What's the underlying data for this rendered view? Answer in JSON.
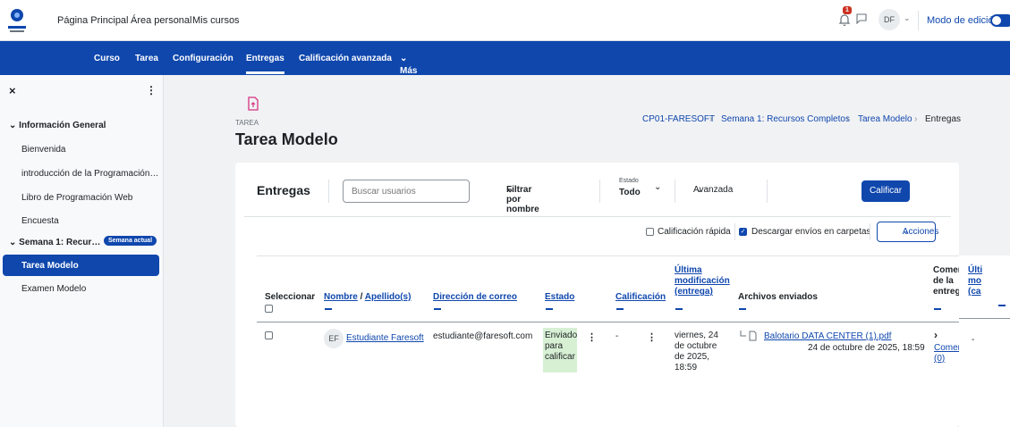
{
  "topnav": {
    "items": [
      "Página Principal",
      "Área personal",
      "Mis cursos"
    ],
    "notif_count": "1",
    "user_initials": "DF",
    "edit_mode_label": "Modo de edición"
  },
  "secondary_nav": [
    "Curso",
    "Tarea",
    "Configuración",
    "Entregas",
    "Calificación avanzada",
    "Más"
  ],
  "drawer": {
    "close": "×",
    "section1": "Información General",
    "items1": [
      "Bienvenida",
      "introducción de la Programación…",
      "Libro de Programación Web",
      "Encuesta"
    ],
    "section2": "Semana 1: Recur…",
    "section2_badge": "Semana actual",
    "items2": [
      "Tarea Modelo",
      "Examen Modelo"
    ]
  },
  "page": {
    "type_label": "TAREA",
    "title": "Tarea Modelo",
    "breadcrumb": [
      "CP01-FARESOFT",
      "Semana 1: Recursos Completos",
      "Tarea Modelo",
      "Entregas"
    ]
  },
  "toolbar": {
    "heading": "Entregas",
    "search_placeholder": "Buscar usuarios",
    "filter_name": "Filtrar por nombre",
    "status_label": "Estado",
    "status_value": "Todo",
    "advanced": "Avanzada",
    "grade_button": "Calificar",
    "quick_grading": "Calificación rápida",
    "download_folders": "Descargar envíos en carpetas",
    "actions": "Acciones"
  },
  "table": {
    "headers": {
      "select": "Seleccionar",
      "name": "Nombre",
      "surname": "Apellido(s)",
      "email": "Dirección de correo",
      "status": "Estado",
      "grade": "Calificación",
      "last_modified": [
        "Última",
        "modificación",
        "(entrega)"
      ],
      "files": "Archivos enviados",
      "comments": [
        "Comentarios",
        "de la",
        "entrega"
      ],
      "last_mod_grade": [
        "Últi",
        "mo",
        "(ca"
      ]
    },
    "row": {
      "initials": "EF",
      "name": "Estudiante Faresoft",
      "email": "estudiante@faresoft.com",
      "status": [
        "Enviado",
        "para",
        "calificar"
      ],
      "grade": "-",
      "modified": [
        "viernes, 24",
        "de octubre",
        "de 2025,",
        "18:59"
      ],
      "file_name": "Balotario DATA CENTER (1).pdf",
      "file_date": "24 de octubre de 2025, 18:59",
      "comments": [
        "Comentarios",
        "(0)"
      ],
      "last_col": "-"
    }
  }
}
